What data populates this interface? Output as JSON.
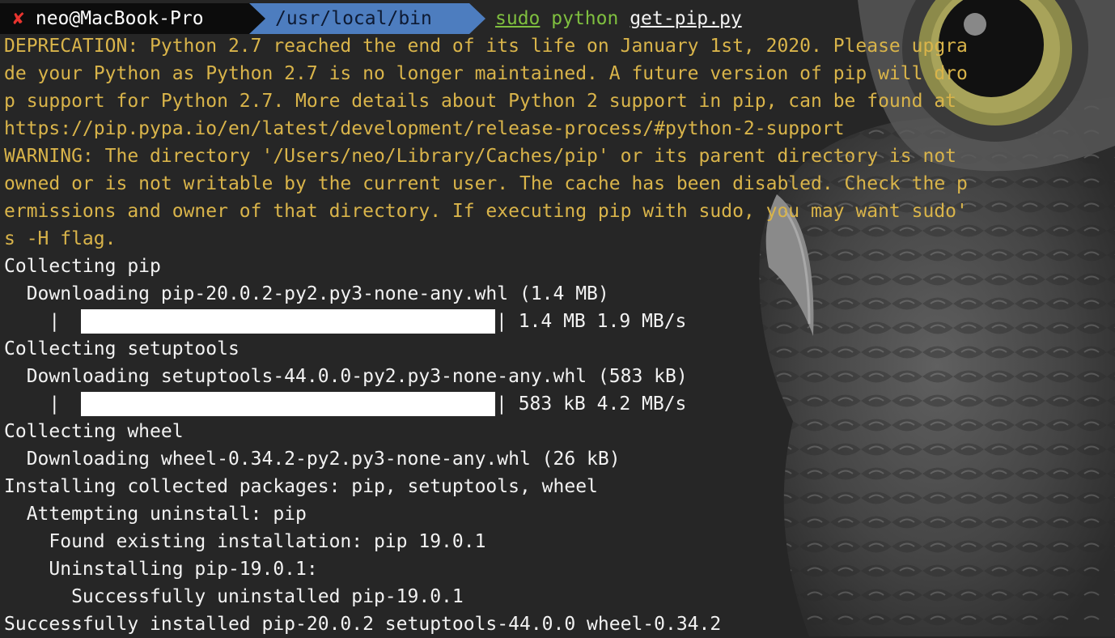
{
  "prompt": {
    "status_symbol": "✘",
    "user_host": "neo@MacBook-Pro",
    "cwd": "/usr/local/bin",
    "command": "sudo",
    "interpreter": "python",
    "argument": "get-pip.py"
  },
  "output": {
    "deprecation": [
      "DEPRECATION: Python 2.7 reached the end of its life on January 1st, 2020. Please upgra",
      "de your Python as Python 2.7 is no longer maintained. A future version of pip will dro",
      "p support for Python 2.7. More details about Python 2 support in pip, can be found at",
      "https://pip.pypa.io/en/latest/development/release-process/#python-2-support"
    ],
    "warning": [
      "WARNING: The directory '/Users/neo/Library/Caches/pip' or its parent directory is not",
      "owned or is not writable by the current user. The cache has been disabled. Check the p",
      "ermissions and owner of that directory. If executing pip with sudo, you may want sudo'",
      "s -H flag."
    ],
    "collecting_pip": "Collecting pip",
    "downloading_pip": "  Downloading pip-20.0.2-py2.py3-none-any.whl (1.4 MB)",
    "pip_bar_left": "    |",
    "pip_bar_right": "| 1.4 MB 1.9 MB/s",
    "collecting_setuptools": "Collecting setuptools",
    "downloading_setuptools": "  Downloading setuptools-44.0.0-py2.py3-none-any.whl (583 kB)",
    "setuptools_bar_left": "    |",
    "setuptools_bar_right": "| 583 kB 4.2 MB/s",
    "collecting_wheel": "Collecting wheel",
    "downloading_wheel": "  Downloading wheel-0.34.2-py2.py3-none-any.whl (26 kB)",
    "installing": "Installing collected packages: pip, setuptools, wheel",
    "attempting": "  Attempting uninstall: pip",
    "found_existing": "    Found existing installation: pip 19.0.1",
    "uninstalling": "    Uninstalling pip-19.0.1:",
    "successfully_uninstalled": "      Successfully uninstalled pip-19.0.1",
    "successfully_installed": "Successfully installed pip-20.0.2 setuptools-44.0.0 wheel-0.34.2"
  },
  "progress": {
    "pip_download_fraction": 1.0,
    "setuptools_download_fraction": 1.0
  },
  "colors": {
    "background": "#262626",
    "warning_text": "#d9b44a",
    "prompt_user_bg": "#0c0c0c",
    "prompt_path_bg": "#4d7dbf",
    "command_green": "#7fbf3f",
    "error_x": "#e8342f"
  },
  "background_image": "owl-wallpaper"
}
